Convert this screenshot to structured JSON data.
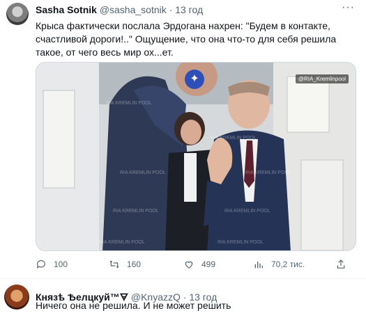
{
  "tweet1": {
    "display_name": "Sasha Sotnik",
    "handle": "@sasha_sotnik",
    "separator": "·",
    "time": "13 год",
    "more": "···",
    "text": "Крыса фактически послала Эрдогана нахрен: \"Будем в контакте, счастливой дороги!..\" Ощущение, что она что-то для себя решила такое, от чего весь мир ох...ет.",
    "media": {
      "watermark": "@RIA_Kremlinpool",
      "overlay_text": "RIA KREMLIN POOL",
      "sparkle_icon": "sparkle-icon"
    },
    "actions": {
      "replies": "100",
      "retweets": "160",
      "likes": "499",
      "views": "70,2 тис."
    }
  },
  "tweet2": {
    "display_name": "Князѣ Ѣелцкуй™",
    "name_suffix": "🜃",
    "handle": "@KnyazzQ",
    "separator": "·",
    "time": "13 год",
    "text": "Ничего она не решила. И не может решить"
  },
  "colors": {
    "muted": "#536471",
    "text": "#0f1419",
    "divider": "#eff3f4"
  }
}
